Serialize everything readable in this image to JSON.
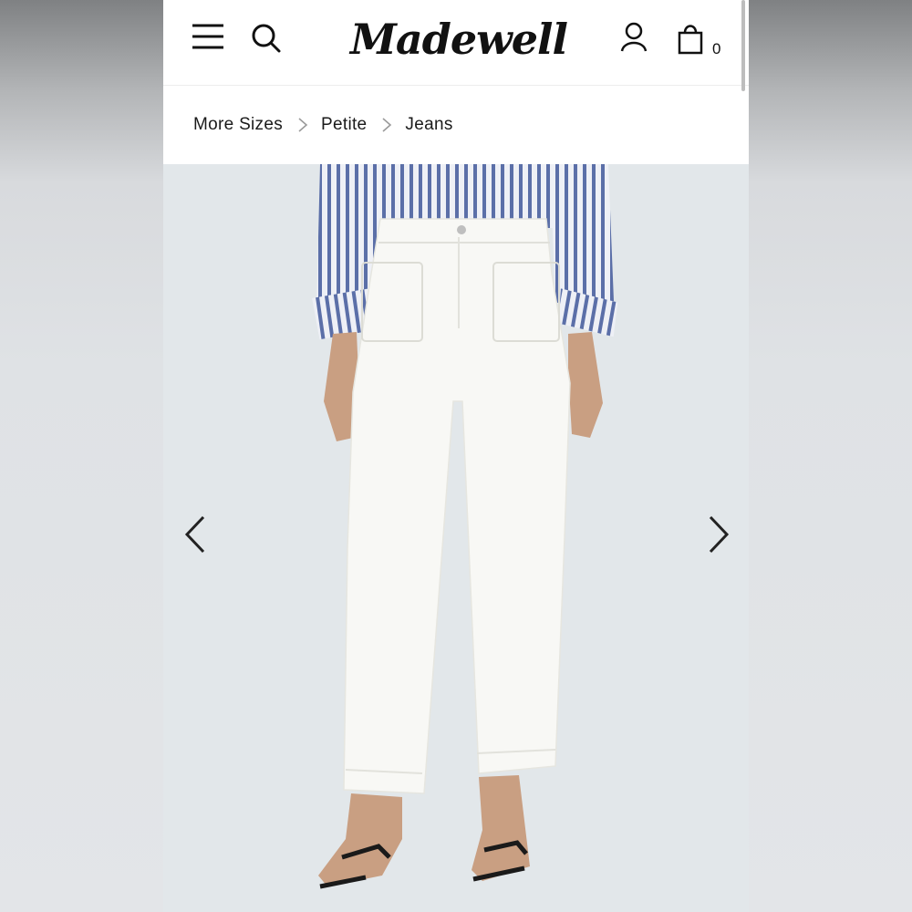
{
  "header": {
    "logo_text": "Madewell",
    "bag_count": "0",
    "icons": [
      "menu-icon",
      "search-icon",
      "account-icon",
      "bag-icon"
    ]
  },
  "breadcrumb": {
    "items": [
      {
        "label": "More Sizes"
      },
      {
        "label": "Petite"
      },
      {
        "label": "Jeans"
      }
    ]
  },
  "hero": {
    "image": "product-photo",
    "nav": [
      "chevron-left-icon",
      "chevron-right-icon"
    ]
  },
  "colors": {
    "header_bg": "#ffffff",
    "text": "#111111",
    "hero_bg": "#e2e7ea"
  }
}
